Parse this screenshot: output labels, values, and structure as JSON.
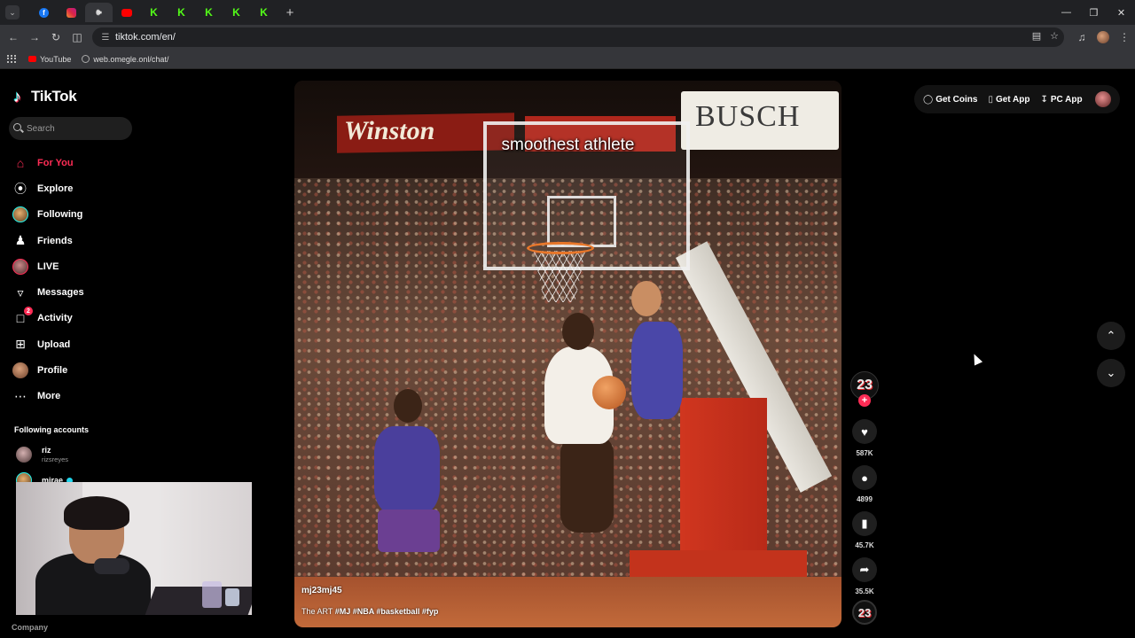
{
  "browser": {
    "tabs": [
      {
        "icon": "facebook-icon"
      },
      {
        "icon": "instagram-icon"
      },
      {
        "icon": "audio-playing-icon",
        "active": true
      },
      {
        "icon": "youtube-icon"
      },
      {
        "icon": "kick-icon",
        "glyph": "K"
      },
      {
        "icon": "kick-icon",
        "glyph": "K"
      },
      {
        "icon": "kick-icon",
        "glyph": "K"
      },
      {
        "icon": "kick-icon",
        "glyph": "K"
      },
      {
        "icon": "kick-icon",
        "glyph": "K"
      }
    ],
    "new_tab_glyph": "+",
    "url": "tiktok.com/en/",
    "bookmarks": [
      {
        "label": "YouTube",
        "icon": "youtube-icon"
      },
      {
        "label": "web.omegle.onl/chat/",
        "icon": "globe-icon"
      }
    ]
  },
  "tiktok": {
    "logo_text": "TikTok",
    "search_placeholder": "Search",
    "nav": [
      {
        "label": "For You",
        "icon": "home-icon",
        "active": true
      },
      {
        "label": "Explore",
        "icon": "compass-icon"
      },
      {
        "label": "Following",
        "icon": "following-avatar"
      },
      {
        "label": "Friends",
        "icon": "friends-icon"
      },
      {
        "label": "LIVE",
        "icon": "live-avatar"
      },
      {
        "label": "Messages",
        "icon": "send-icon"
      },
      {
        "label": "Activity",
        "icon": "activity-icon",
        "badge": "2"
      },
      {
        "label": "Upload",
        "icon": "upload-icon"
      },
      {
        "label": "Profile",
        "icon": "profile-avatar"
      },
      {
        "label": "More",
        "icon": "more-icon"
      }
    ],
    "following_title": "Following accounts",
    "following_accounts": [
      {
        "name": "riz",
        "handle": "rizsreyes"
      },
      {
        "name": "mirae",
        "handle": "",
        "verified": true
      }
    ],
    "company_label": "Company",
    "top_actions": {
      "get_coins": "Get Coins",
      "get_app": "Get App",
      "pc_app": "PC App"
    },
    "video": {
      "caption_overlay": "smoothest athlete",
      "author": "mj23mj45",
      "description_prefix": "The ART ",
      "hashtags": "#MJ #NBA #basketball #fyp",
      "scene_text_left": "Winston",
      "scene_text_right": "BUSCH"
    },
    "actions": {
      "creator_badge": "23",
      "likes": "587K",
      "comments": "4899",
      "bookmarks": "45.7K",
      "shares": "35.5K",
      "music_badge": "23"
    }
  },
  "colors": {
    "accent": "#fe2c55",
    "background": "#000000",
    "browser_dark": "#202124",
    "browser_toolbar": "#35363a"
  }
}
